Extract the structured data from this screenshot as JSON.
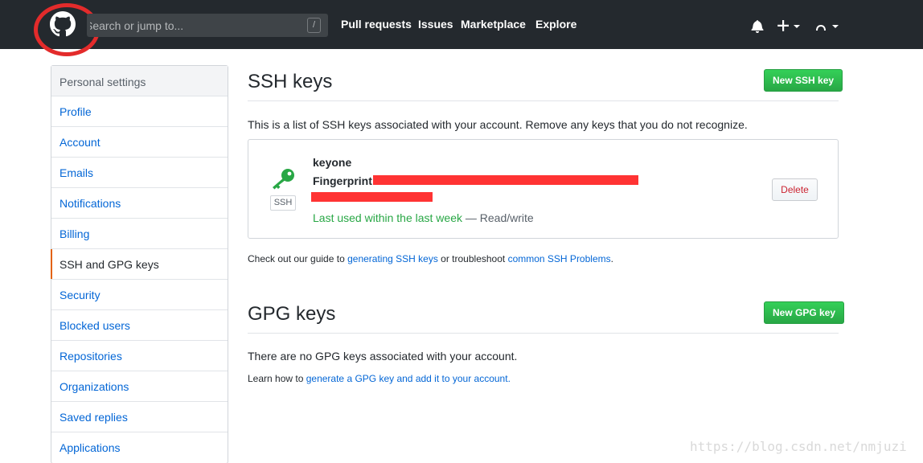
{
  "header": {
    "search": {
      "placeholder": "Search or jump to...",
      "shortcut": "/"
    },
    "nav": [
      "Pull requests",
      "Issues",
      "Marketplace",
      "Explore"
    ]
  },
  "sidebar": {
    "heading": "Personal settings",
    "items": [
      "Profile",
      "Account",
      "Emails",
      "Notifications",
      "Billing",
      "SSH and GPG keys",
      "Security",
      "Blocked users",
      "Repositories",
      "Organizations",
      "Saved replies",
      "Applications"
    ],
    "selected": "SSH and GPG keys"
  },
  "ssh": {
    "title": "SSH keys",
    "new_button": "New SSH key",
    "description": "This is a list of SSH keys associated with your account. Remove any keys that you do not recognize.",
    "key": {
      "name": "keyone",
      "type_label": "SSH",
      "fingerprint_label": "Fingerprint:",
      "last_used": "Last used within the last week",
      "access": "— Read/write",
      "delete_button": "Delete"
    },
    "guide": {
      "prefix": "Check out our guide to",
      "link1": "generating SSH keys",
      "middle": "or troubleshoot",
      "link2": "common SSH Problems",
      "suffix": "."
    }
  },
  "gpg": {
    "title": "GPG keys",
    "new_button": "New GPG key",
    "empty": "There are no GPG keys associated with your account.",
    "learn": {
      "prefix": "Learn how to",
      "link": "generate a GPG key and add it to your account",
      "suffix": "."
    }
  },
  "watermark": "https://blog.csdn.net/nmjuzi",
  "colors": {
    "header_bg": "#24292e",
    "link": "#0366d6",
    "green": "#28a745",
    "redaction": "#ff3333",
    "annotation_circle": "#e32b2b"
  },
  "icons": [
    "github-mark-icon",
    "bell-icon",
    "plus-icon",
    "avatar-icon",
    "key-icon"
  ]
}
